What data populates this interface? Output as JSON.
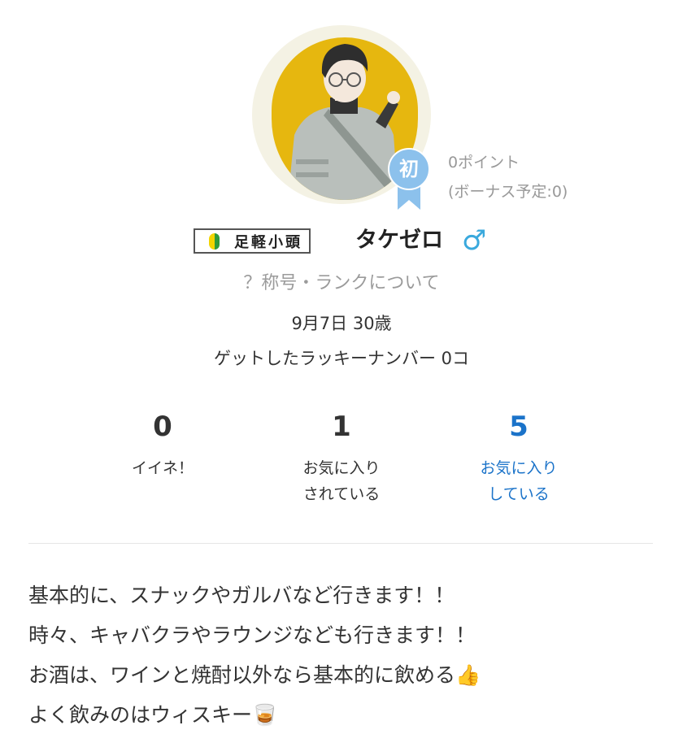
{
  "profile": {
    "username": "タケゼロ",
    "gender_icon": "male-icon",
    "gender_symbol": "♂",
    "avatar_icon": "avatar-illustration",
    "rank_badge": {
      "icon": "ribbon-badge-icon",
      "label": "初"
    },
    "points": "0ポイント",
    "bonus": "(ボーナス予定:0)",
    "title_badge": {
      "icon": "wakaba-beginner-icon",
      "label": "足軽小頭"
    },
    "rank_link": "？称号・ランクについて",
    "birthday": "9月7日 30歳",
    "lucky_numbers": "ゲットしたラッキーナンバー 0コ"
  },
  "stats": [
    {
      "value": "0",
      "label_line1": "イイネ！",
      "label_line2": ""
    },
    {
      "value": "1",
      "label_line1": "お気に入り",
      "label_line2": "されている"
    },
    {
      "value": "5",
      "label_line1": "お気に入り",
      "label_line2": "している"
    }
  ],
  "bio": {
    "lines": [
      "基本的に、スナックやガルバなど行きます！！",
      "時々、キャバクラやラウンジなども行きます！！",
      "お酒は、ワインと焼酎以外なら基本的に飲める👍",
      "よく飲みのはウィスキー🥃"
    ]
  },
  "colors": {
    "accent_link": "#1b73c9",
    "badge_blue": "#8cc1ec",
    "avatar_bg": "#e6b70f",
    "gender_blue": "#3aa9dd"
  }
}
